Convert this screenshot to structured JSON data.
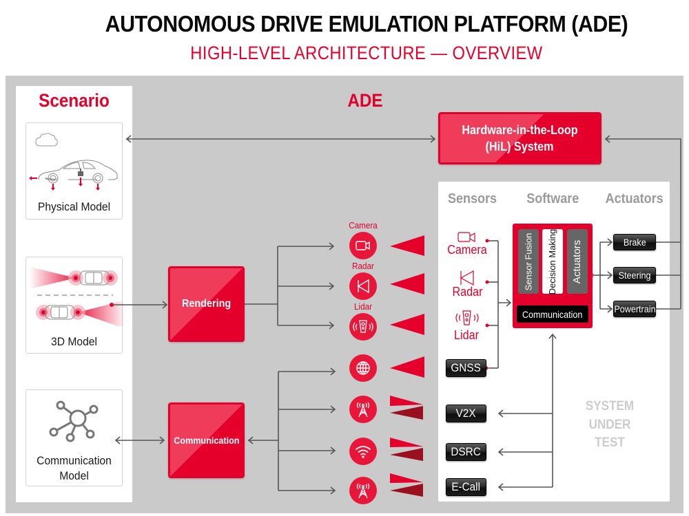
{
  "header": {
    "title": "AUTONOMOUS DRIVE EMULATION PLATFORM (ADE)",
    "subtitle": "HIGH-LEVEL ARCHITECTURE — OVERVIEW"
  },
  "scenario": {
    "title": "Scenario",
    "cards": [
      {
        "label": "Physical Model",
        "icon": "car-physics-icon"
      },
      {
        "label": "3D Model",
        "icon": "car-sensors-3d-icon"
      },
      {
        "label_line1": "Communication",
        "label_line2": "Model",
        "icon": "network-hub-icon"
      }
    ]
  },
  "ade": {
    "title": "ADE",
    "hil": {
      "line1": "Hardware-in-the-Loop",
      "line2": "(HiL) System"
    },
    "rendering": "Rendering",
    "communication": "Communication",
    "sensor_emulators": [
      {
        "label": "Camera",
        "icon": "camera-icon"
      },
      {
        "label": "Radar",
        "icon": "radar-icon"
      },
      {
        "label": "Lidar",
        "icon": "lidar-icon"
      }
    ],
    "comm_emulators": [
      {
        "icon": "globe-icon"
      },
      {
        "icon": "antenna-icon"
      },
      {
        "icon": "wifi-icon"
      },
      {
        "icon": "antenna-icon"
      }
    ]
  },
  "sut": {
    "columns": {
      "sensors": "Sensors",
      "software": "Software",
      "actuators": "Actuators"
    },
    "sensors": [
      {
        "label": "Camera",
        "icon": "camera-icon"
      },
      {
        "label": "Radar",
        "icon": "radar-icon"
      },
      {
        "label": "Lidar",
        "icon": "lidar-icon"
      }
    ],
    "gnss": "GNSS",
    "comm_units": [
      "V2X",
      "DSRC",
      "E-Call"
    ],
    "software": {
      "sensor_fusion": "Sensor Fusion",
      "decision_making": "Decision Making",
      "actuators": "Actuators",
      "communication": "Communication"
    },
    "actuators": [
      "Brake",
      "Steering",
      "Powertrain"
    ],
    "label_lines": [
      "SYSTEM",
      "UNDER",
      "TEST"
    ]
  },
  "colors": {
    "accent_red": "#e4002b",
    "dark_red": "#9b1020",
    "frame_gray": "#cacaca",
    "label_gray": "#9a9a9a"
  }
}
